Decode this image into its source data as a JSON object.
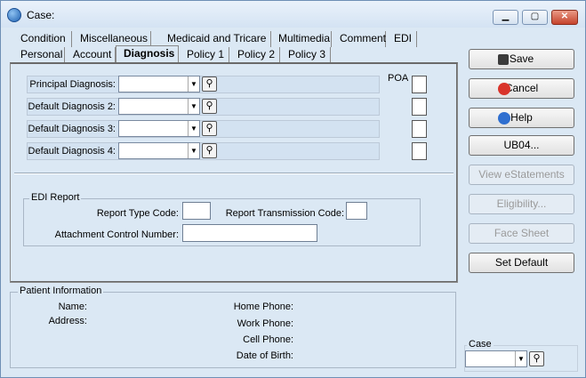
{
  "window": {
    "title": "Case:",
    "buttons": {
      "minimize": "▁",
      "maximize": "▢",
      "close": "✕"
    }
  },
  "tabs": {
    "row1": [
      "Condition",
      "Miscellaneous",
      "Medicaid and Tricare",
      "Multimedia",
      "Comment",
      "EDI"
    ],
    "row2": [
      "Personal",
      "Account",
      "Diagnosis",
      "Policy 1",
      "Policy 2",
      "Policy 3"
    ],
    "active": "Diagnosis"
  },
  "diagnosis": {
    "poa_label": "POA",
    "rows": [
      {
        "label": "Principal Diagnosis:",
        "value": ""
      },
      {
        "label": "Default Diagnosis 2:",
        "value": ""
      },
      {
        "label": "Default Diagnosis 3:",
        "value": ""
      },
      {
        "label": "Default Diagnosis 4:",
        "value": ""
      }
    ]
  },
  "edi_report": {
    "title": "EDI Report",
    "report_type_label": "Report Type Code:",
    "report_type_value": "",
    "transmission_label": "Report Transmission Code:",
    "transmission_value": "",
    "attachment_label": "Attachment Control Number:",
    "attachment_value": ""
  },
  "patient_info": {
    "title": "Patient Information",
    "name_label": "Name:",
    "address_label": "Address:",
    "home_phone_label": "Home Phone:",
    "work_phone_label": "Work Phone:",
    "cell_phone_label": "Cell Phone:",
    "dob_label": "Date of Birth:"
  },
  "actions": {
    "save": "Save",
    "cancel": "Cancel",
    "help": "Help",
    "ub04": "UB04...",
    "view_estatements": "View eStatements",
    "eligibility": "Eligibility...",
    "face_sheet": "Face Sheet",
    "set_default": "Set Default"
  },
  "case_selector": {
    "label": "Case",
    "value": ""
  },
  "icons": [
    "app-icon",
    "save-icon",
    "cancel-icon",
    "help-icon",
    "lookup-icon",
    "dropdown-arrow-icon"
  ],
  "colors": {
    "window_bg": "#dbe8f4",
    "accent": "#1d5fb0",
    "cancel_red": "#d9342b"
  }
}
